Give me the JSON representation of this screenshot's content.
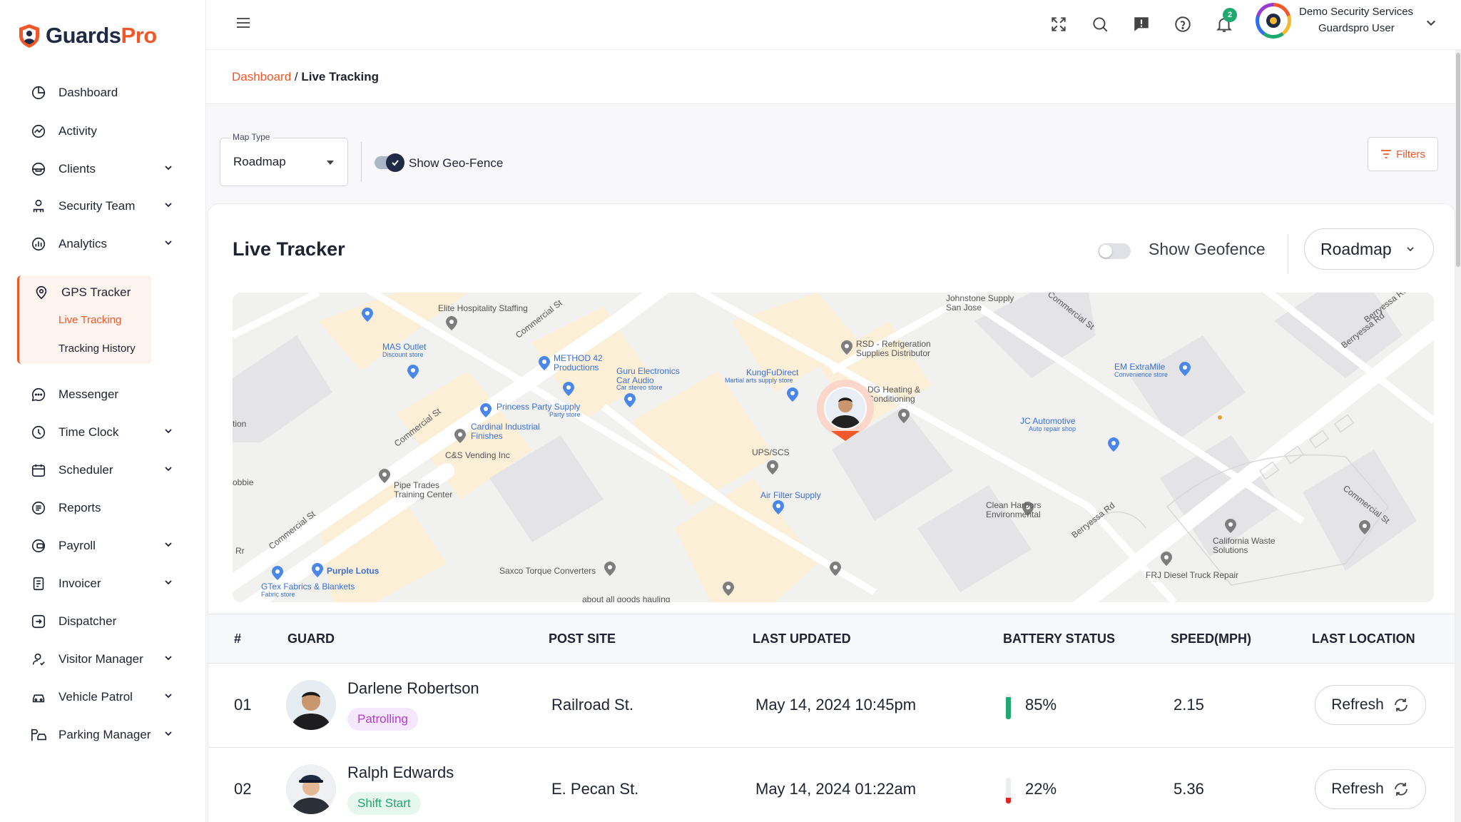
{
  "brand": {
    "name_part1": "Guards",
    "name_part2": "Pro",
    "accent": "#f0582a",
    "primary": "#1f2a44"
  },
  "sidebar": {
    "items": [
      {
        "label": "Dashboard",
        "icon": "dashboard-icon"
      },
      {
        "label": "Activity",
        "icon": "activity-icon"
      },
      {
        "label": "Clients",
        "icon": "clients-icon",
        "expandable": true
      },
      {
        "label": "Security Team",
        "icon": "security-team-icon",
        "expandable": true
      },
      {
        "label": "Analytics",
        "icon": "analytics-icon",
        "expandable": true
      },
      {
        "label": "GPS Tracker",
        "icon": "gps-icon",
        "active": true
      },
      {
        "label": "Messenger",
        "icon": "messenger-icon"
      },
      {
        "label": "Time Clock",
        "icon": "clock-icon",
        "expandable": true
      },
      {
        "label": "Scheduler",
        "icon": "calendar-icon",
        "expandable": true
      },
      {
        "label": "Reports",
        "icon": "reports-icon"
      },
      {
        "label": "Payroll",
        "icon": "payroll-icon",
        "expandable": true
      },
      {
        "label": "Invoicer",
        "icon": "invoice-icon",
        "expandable": true
      },
      {
        "label": "Dispatcher",
        "icon": "dispatcher-icon"
      },
      {
        "label": "Visitor Manager",
        "icon": "visitor-icon",
        "expandable": true
      },
      {
        "label": "Vehicle Patrol",
        "icon": "vehicle-icon",
        "expandable": true
      },
      {
        "label": "Parking Manager",
        "icon": "parking-icon",
        "expandable": true
      }
    ],
    "gps_sub": [
      {
        "label": "Live Tracking",
        "active": true
      },
      {
        "label": "Tracking History",
        "active": false
      }
    ]
  },
  "topbar": {
    "notification_count": "2",
    "company": "Demo Security Services",
    "user": "Guardspro User"
  },
  "breadcrumb": {
    "root": "Dashboard",
    "sep": " / ",
    "current": "Live Tracking"
  },
  "controls": {
    "map_type_label": "Map Type",
    "map_type_value": "Roadmap",
    "geofence_label": "Show Geo-Fence",
    "geofence_on": true,
    "filters_label": "Filters"
  },
  "tracker": {
    "title": "Live Tracker",
    "geofence_label": "Show Geofence",
    "geofence_on": false,
    "map_type": "Roadmap"
  },
  "map": {
    "roads": [
      "Commercial St",
      "Commercial St",
      "Commercial St",
      "Commercial St",
      "Commercial St",
      "Berryessa Rd",
      "Berryessa Rd",
      "Berryessa Rd",
      "Commercial St"
    ],
    "places": [
      {
        "name": "Elite Hospitality Staffing",
        "sub": ""
      },
      {
        "name": "MAS Outlet",
        "sub": "Discount store"
      },
      {
        "name": "METHOD 42 Productions",
        "sub": ""
      },
      {
        "name": "Guru Electronics Car Audio",
        "sub": "Car stereo store"
      },
      {
        "name": "Princess Party Supply",
        "sub": "Party store"
      },
      {
        "name": "Cardinal Industrial Finishes",
        "sub": ""
      },
      {
        "name": "C&S Vending Inc",
        "sub": ""
      },
      {
        "name": "Pipe Trades Training Center",
        "sub": ""
      },
      {
        "name": "KungFuDirect",
        "sub": "Martial arts supply store"
      },
      {
        "name": "RSD - Refrigeration Supplies Distributor",
        "sub": ""
      },
      {
        "name": "Johnstone Supply San Jose",
        "sub": ""
      },
      {
        "name": "DG Heating & Conditioning",
        "sub": ""
      },
      {
        "name": "EM ExtraMile",
        "sub": "Convenience store"
      },
      {
        "name": "JC Automotive",
        "sub": "Auto repair shop"
      },
      {
        "name": "UPS/SCS",
        "sub": ""
      },
      {
        "name": "Air Filter Supply",
        "sub": ""
      },
      {
        "name": "Clean Harbors Environmental",
        "sub": ""
      },
      {
        "name": "California Waste Solutions",
        "sub": ""
      },
      {
        "name": "FRJ Diesel Truck Repair",
        "sub": ""
      },
      {
        "name": "Saxco Torque Converters",
        "sub": ""
      },
      {
        "name": "Purple Lotus",
        "sub": ""
      },
      {
        "name": "GTex Fabrics & Blankets",
        "sub": "Fabric store"
      },
      {
        "name": "about all goods hauling",
        "sub": ""
      },
      {
        "name": "tion",
        "sub": ""
      },
      {
        "name": "obbie",
        "sub": ""
      },
      {
        "name": "Rr",
        "sub": ""
      }
    ]
  },
  "table": {
    "headers": [
      "#",
      "GUARD",
      "POST SITE",
      "LAST UPDATED",
      "BATTERY STATUS",
      "SPEED(MPH)",
      "LAST LOCATION"
    ],
    "rows": [
      {
        "num": "01",
        "name": "Darlene Robertson",
        "status": "Patrolling",
        "status_fg": "#b23bd6",
        "status_bg": "#f6e8fc",
        "site": "Railroad St.",
        "updated": "May 14, 2024 10:45pm",
        "battery": "85%",
        "battery_level": 0.85,
        "battery_color": "#1fa86f",
        "speed": "2.15",
        "action": "Refresh"
      },
      {
        "num": "02",
        "name": "Ralph Edwards",
        "status": "Shift Start",
        "status_fg": "#1fa86f",
        "status_bg": "#e6f7ef",
        "site": "E. Pecan St.",
        "updated": "May 14, 2024 01:22am",
        "battery": "22%",
        "battery_level": 0.22,
        "battery_color": "#e02424",
        "speed": "5.36",
        "action": "Refresh"
      }
    ]
  }
}
